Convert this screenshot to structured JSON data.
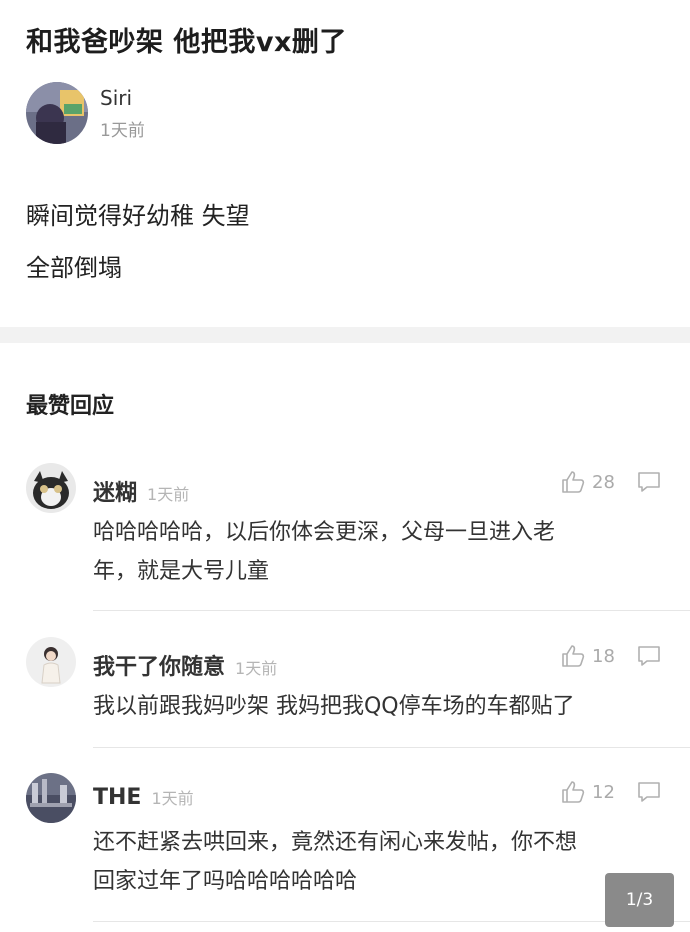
{
  "post": {
    "title": "和我爸吵架 他把我vx删了",
    "author": {
      "name": "Siri",
      "time": "1天前"
    },
    "body_lines": [
      "瞬间觉得好幼稚 失望",
      "全部倒塌"
    ]
  },
  "section": {
    "title": "最赞回应"
  },
  "comments": [
    {
      "name": "迷糊",
      "time": "1天前",
      "likes": "28",
      "text_lines": [
        "哈哈哈哈哈，以后你体会更深，父母一旦进入老",
        "年，就是大号儿童"
      ]
    },
    {
      "name": "我干了你随意",
      "time": "1天前",
      "likes": "18",
      "text_lines": [
        "我以前跟我妈吵架 我妈把我QQ停车场的车都贴了"
      ]
    },
    {
      "name": "THE",
      "time": "1天前",
      "likes": "12",
      "text_lines": [
        "还不赶紧去哄回来，竟然还有闲心来发帖，你不想",
        "回家过年了吗哈哈哈哈哈哈"
      ]
    }
  ],
  "pager": {
    "label": "1/3"
  },
  "icons": {
    "like": "thumbs-up-icon",
    "reply": "comment-bubble-icon"
  },
  "colors": {
    "muted": "#999999",
    "divider_band": "#f2f2f2",
    "pager_bg": "#8a8a8a"
  }
}
